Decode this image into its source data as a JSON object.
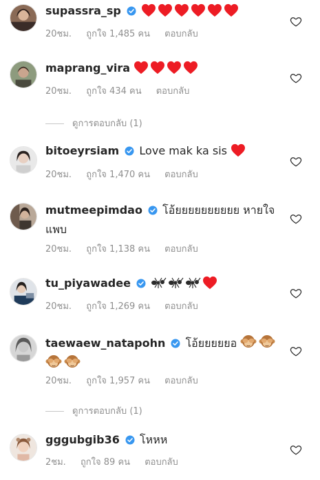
{
  "ui": {
    "verified_color": "#3897f0",
    "heart_color": "#ed1c24",
    "meta_color": "#8e8e8e"
  },
  "comments": [
    {
      "username": "supassra_sp",
      "verified": true,
      "text": "",
      "emojis": [
        "heart",
        "heart",
        "heart",
        "heart",
        "heart",
        "heart"
      ],
      "time": "20ชม.",
      "likes": "ถูกใจ 1,485 คน",
      "reply": "ตอบกลับ"
    },
    {
      "username": "maprang_vira",
      "verified": false,
      "text": "",
      "emojis": [
        "heart",
        "heart",
        "heart",
        "heart"
      ],
      "time": "20ชม.",
      "likes": "ถูกใจ 434 คน",
      "reply": "ตอบกลับ",
      "view_replies": "ดูการตอบกลับ (1)"
    },
    {
      "username": "bitoeyrsiam",
      "verified": true,
      "text": "Love mak ka sis",
      "emojis": [
        "heart"
      ],
      "time": "20ชม.",
      "likes": "ถูกใจ 1,470 คน",
      "reply": "ตอบกลับ"
    },
    {
      "username": "mutmeepimdao",
      "verified": true,
      "text": "โอ้ยยยยยยยยยย หายใจแพบ",
      "emojis": [],
      "time": "20ชม.",
      "likes": "ถูกใจ 1,138 คน",
      "reply": "ตอบกลับ"
    },
    {
      "username": "tu_piyawadee",
      "verified": true,
      "text": "",
      "emojis": [
        "ant",
        "ant",
        "ant",
        "heart"
      ],
      "time": "20ชม.",
      "likes": "ถูกใจ 1,269 คน",
      "reply": "ตอบกลับ"
    },
    {
      "username": "taewaew_natapohn",
      "verified": true,
      "text": "โอ้ยยยยยอ",
      "emojis": [
        "see-no-evil-monkey",
        "see-no-evil-monkey",
        "see-no-evil-monkey",
        "see-no-evil-monkey"
      ],
      "time": "20ชม.",
      "likes": "ถูกใจ 1,957 คน",
      "reply": "ตอบกลับ",
      "view_replies": "ดูการตอบกลับ (1)"
    },
    {
      "username": "gggubgib36",
      "verified": true,
      "text": "โหหห",
      "emojis": [],
      "time": "2ชม.",
      "likes": "ถูกใจ 89 คน",
      "reply": "ตอบกลับ"
    }
  ]
}
